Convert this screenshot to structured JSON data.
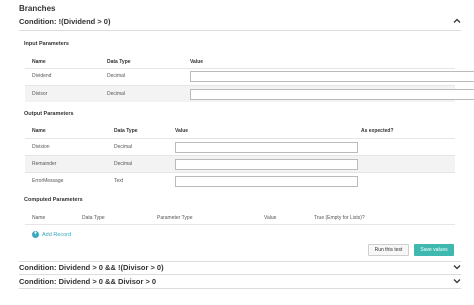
{
  "page": {
    "title": "Branches"
  },
  "conditions": [
    {
      "label": "Condition: !(Dividend > 0)",
      "expanded": true
    },
    {
      "label": "Condition: Dividend > 0 && !(Divisor > 0)",
      "expanded": false
    },
    {
      "label": "Condition: Dividend > 0 && Divisor > 0",
      "expanded": false
    }
  ],
  "input_params": {
    "title": "Input Parameters",
    "headers": [
      "Name",
      "Data Type",
      "Value"
    ],
    "rows": [
      {
        "name": "Dividend",
        "type": "Decimal",
        "value": ""
      },
      {
        "name": "Divisor",
        "type": "Decimal",
        "value": ""
      }
    ]
  },
  "output_params": {
    "title": "Output Parameters",
    "headers": [
      "Name",
      "Data Type",
      "Value",
      "As expected?"
    ],
    "rows": [
      {
        "name": "Division",
        "type": "Decimal",
        "value": ""
      },
      {
        "name": "Remainder",
        "type": "Decimal",
        "value": ""
      },
      {
        "name": "ErrorMessage",
        "type": "Text",
        "value": ""
      }
    ]
  },
  "computed_params": {
    "title": "Computed Parameters",
    "headers": [
      "Name",
      "Data Type",
      "Parameter Type",
      "Value",
      "True (Empty for Lists)?"
    ],
    "add_label": "Add Record"
  },
  "actions": {
    "run": "Run this test",
    "save": "Save values"
  },
  "colors": {
    "accent": "#3fb9b0",
    "link": "#3aa6b9"
  }
}
